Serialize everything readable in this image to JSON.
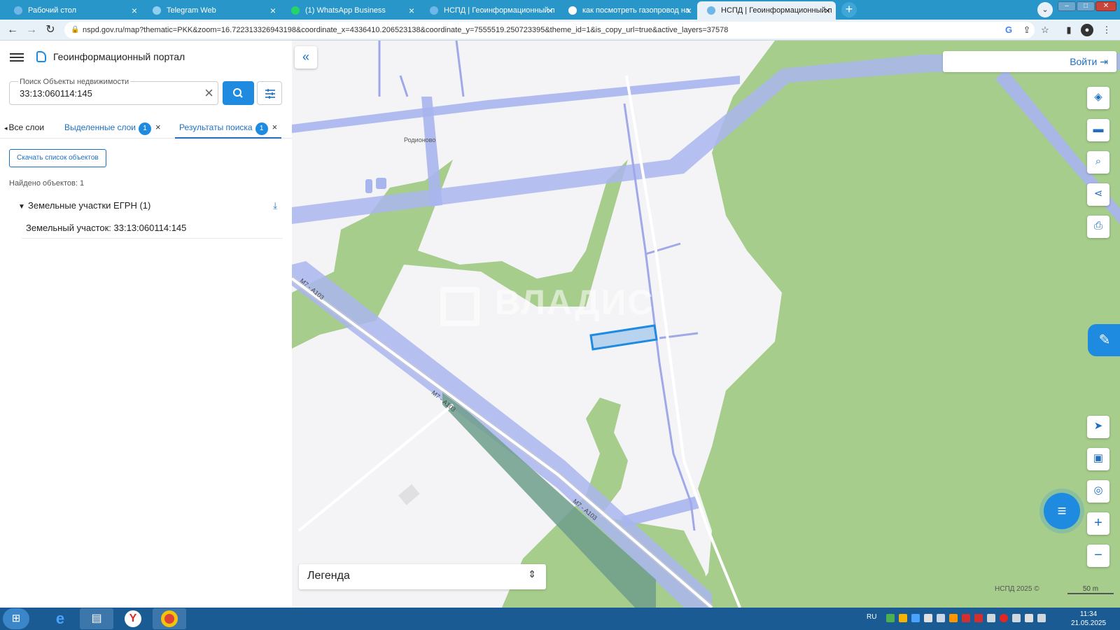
{
  "browser": {
    "tabs": [
      {
        "title": "Рабочий стол",
        "color": "#1f8be0"
      },
      {
        "title": "Telegram Web",
        "color": "#2aa3e0"
      },
      {
        "title": "(1) WhatsApp Business",
        "color": "#25d366"
      },
      {
        "title": "НСПД | Геоинформационный п",
        "color": "#1f8be0"
      },
      {
        "title": "как посмотреть газопровод на",
        "color": "#ea4335"
      },
      {
        "title": "НСПД | Геоинформационный п",
        "color": "#1f8be0"
      }
    ],
    "active_tab_index": 5,
    "new_tab_label": "+",
    "url": "nspd.gov.ru/map?thematic=PKK&zoom=16.722313326943198&coordinate_x=4336410.206523138&coordinate_y=7555519.250723395&theme_id=1&is_copy_url=true&active_layers=37578"
  },
  "sidebar": {
    "portal_title": "Геоинформационный портал",
    "search": {
      "label": "Поиск Объекты недвижимости",
      "value": "33:13:060114:145"
    },
    "tabs": [
      {
        "label": "Все слои"
      },
      {
        "label": "Выделенные слои",
        "badge": "1"
      },
      {
        "label": "Результаты поиска",
        "badge": "1"
      }
    ],
    "download_list_label": "Скачать список объектов",
    "found_count": "Найдено объектов: 1",
    "group": {
      "label": "Земельные участки ЕГРН (1)"
    },
    "result_item": "Земельный участок: 33:13:060114:145"
  },
  "map": {
    "login_label": "Войти",
    "place_label": "Родионово",
    "road_labels": [
      "М7 - А103",
      "М7 - А103",
      "М7 - А103"
    ],
    "watermark": "ВЛАДИС",
    "legend_label": "Легенда",
    "copyright": "НСПД 2025 ©",
    "scale": "50 m",
    "colors": {
      "forest": "#a6cd8c",
      "zone": "#a9b5ee",
      "parcel_stroke": "#1f8be0",
      "parcel_fill": "#b8d3ee",
      "overlap": "#6f9e8c"
    }
  },
  "taskbar": {
    "lang": "RU",
    "time": "11:34",
    "date": "21.05.2025"
  }
}
